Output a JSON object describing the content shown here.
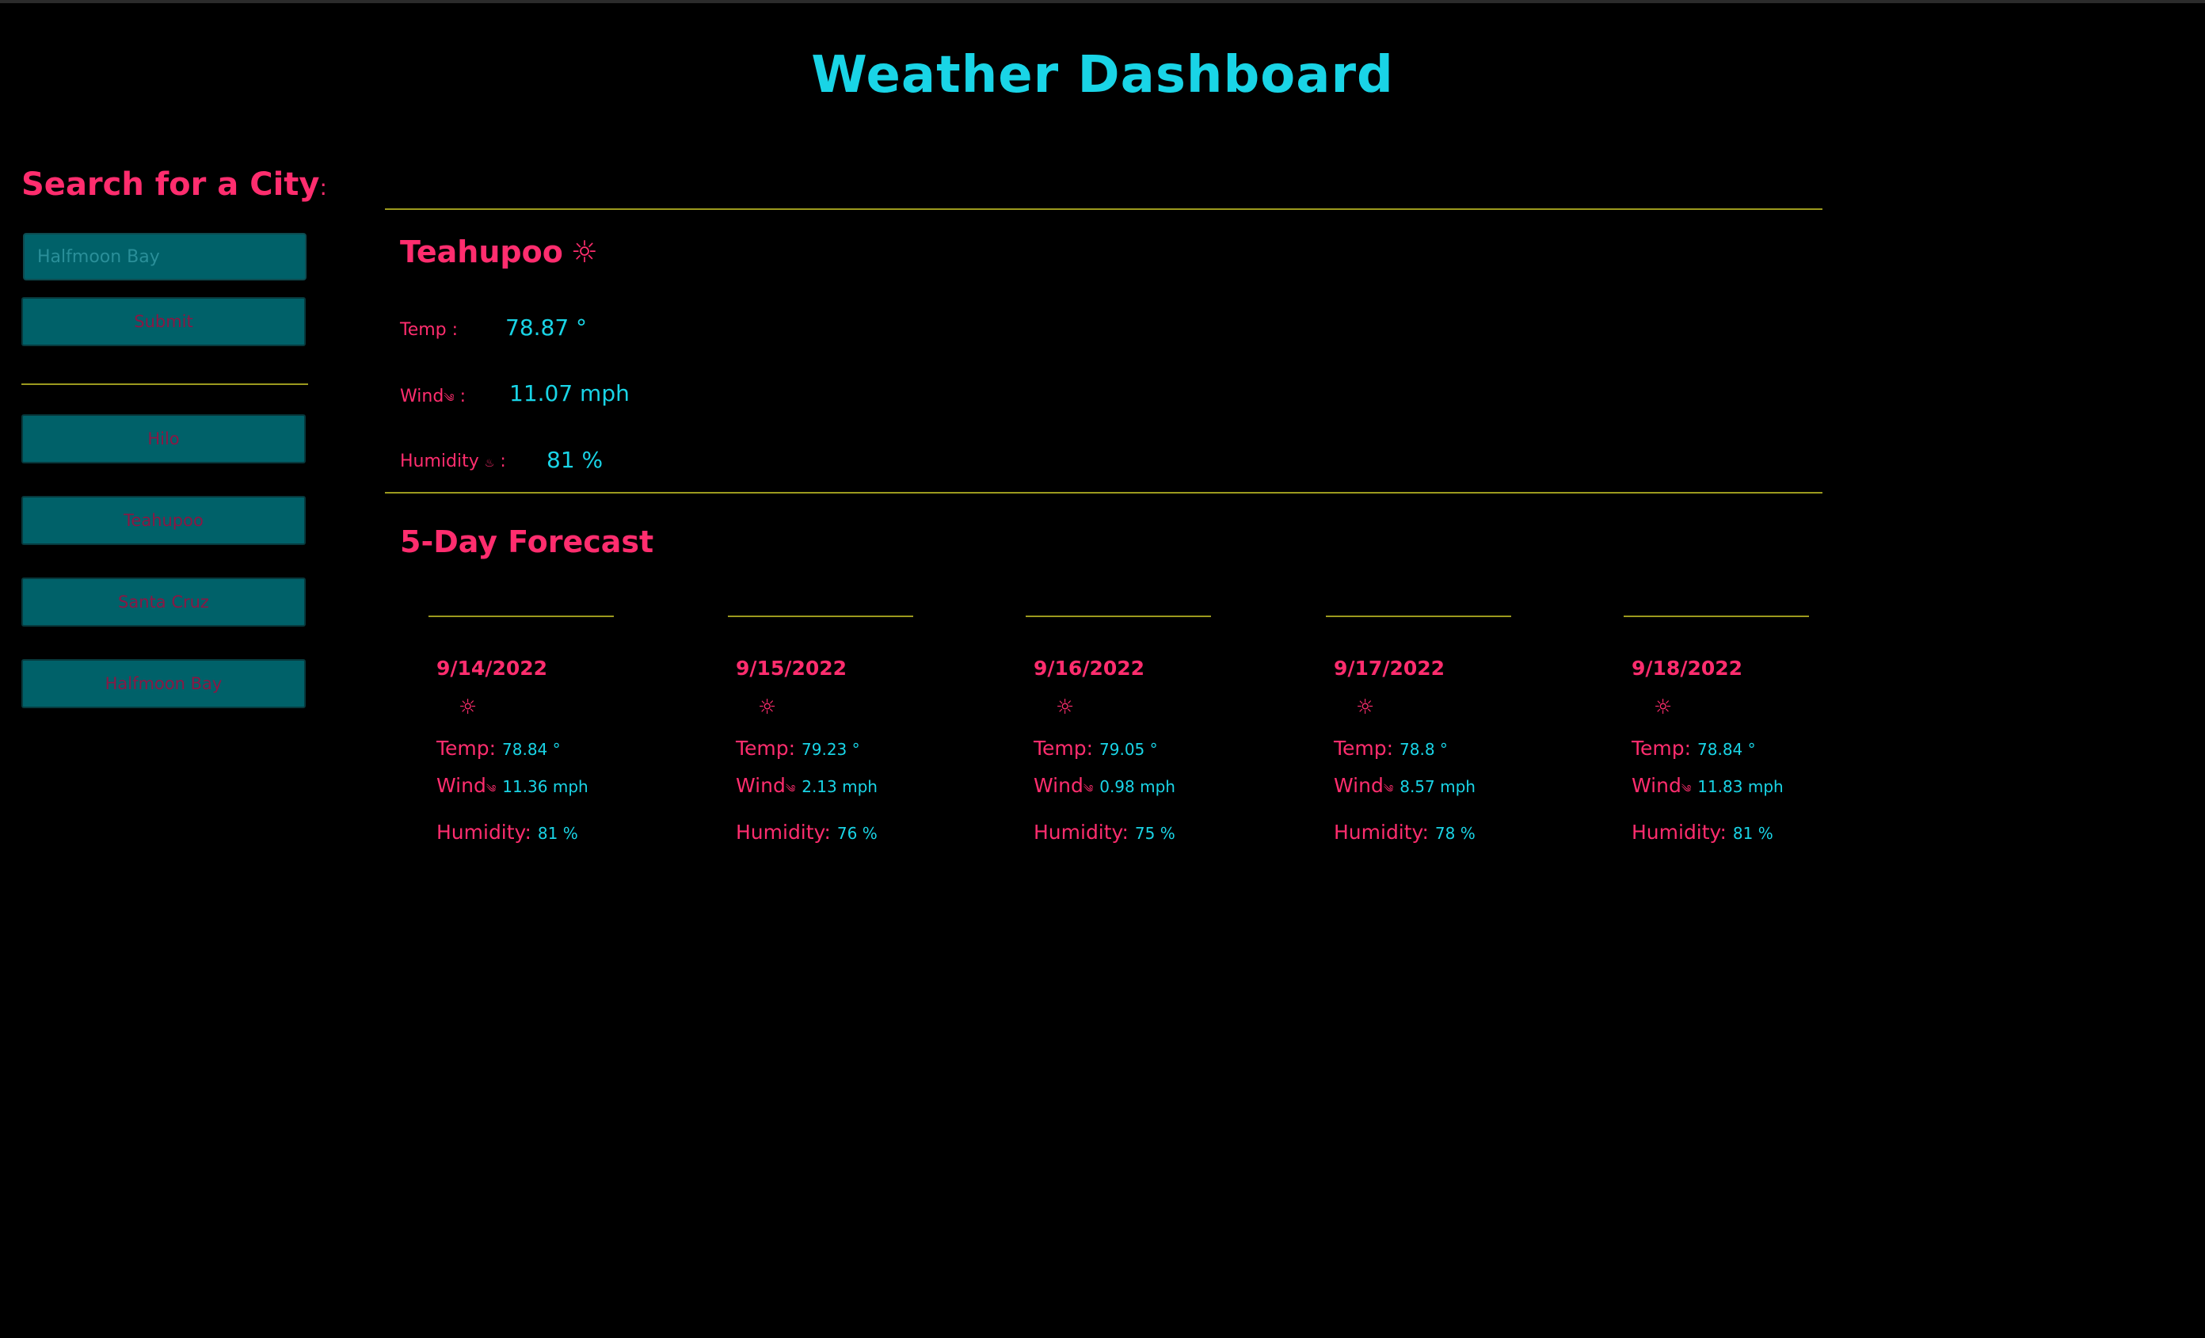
{
  "app": {
    "title": "Weather Dashboard"
  },
  "sidebar": {
    "heading": "Search for a City",
    "heading_colon": ":",
    "search_placeholder": "Halfmoon Bay",
    "submit_label": "Submit",
    "history": [
      "Hilo",
      "Teahupoo",
      "Santa Cruz",
      "Halfmoon Bay"
    ]
  },
  "current": {
    "city": "Teahupoo",
    "icon": "☼",
    "temp_label": "Temp :",
    "temp_value": "78.87 °",
    "wind_label": "Wind",
    "wind_icon": "༄",
    "wind_colon": ":",
    "wind_value": "11.07 mph",
    "humidity_label": "Humidity",
    "humidity_icon": "♨",
    "humidity_colon": ":",
    "humidity_value": "81 %"
  },
  "forecast": {
    "heading": "5-Day Forecast",
    "days": [
      {
        "date": "9/14/2022",
        "icon": "☼",
        "temp_label": "Temp:",
        "temp": "78.84 °",
        "wind_label": "Wind",
        "wind_icon": "༄",
        "wind": "11.36 mph",
        "humidity_label": "Humidity:",
        "humidity": "81 %"
      },
      {
        "date": "9/15/2022",
        "icon": "☼",
        "temp_label": "Temp:",
        "temp": "79.23 °",
        "wind_label": "Wind",
        "wind_icon": "༄",
        "wind": "2.13 mph",
        "humidity_label": "Humidity:",
        "humidity": "76 %"
      },
      {
        "date": "9/16/2022",
        "icon": "☼",
        "temp_label": "Temp:",
        "temp": "79.05 °",
        "wind_label": "Wind",
        "wind_icon": "༄",
        "wind": "0.98 mph",
        "humidity_label": "Humidity:",
        "humidity": "75 %"
      },
      {
        "date": "9/17/2022",
        "icon": "☼",
        "temp_label": "Temp:",
        "temp": "78.8 °",
        "wind_label": "Wind",
        "wind_icon": "༄",
        "wind": "8.57 mph",
        "humidity_label": "Humidity:",
        "humidity": "78 %"
      },
      {
        "date": "9/18/2022",
        "icon": "☼",
        "temp_label": "Temp:",
        "temp": "78.84 °",
        "wind_label": "Wind",
        "wind_icon": "༄",
        "wind": "11.83 mph",
        "humidity_label": "Humidity:",
        "humidity": "81 %"
      }
    ]
  },
  "colors": {
    "background": "#000000",
    "accent_cyan": "#19d4e6",
    "accent_pink": "#ff2d6e",
    "button_teal": "#006169",
    "divider_olive": "#9c9a1e"
  }
}
